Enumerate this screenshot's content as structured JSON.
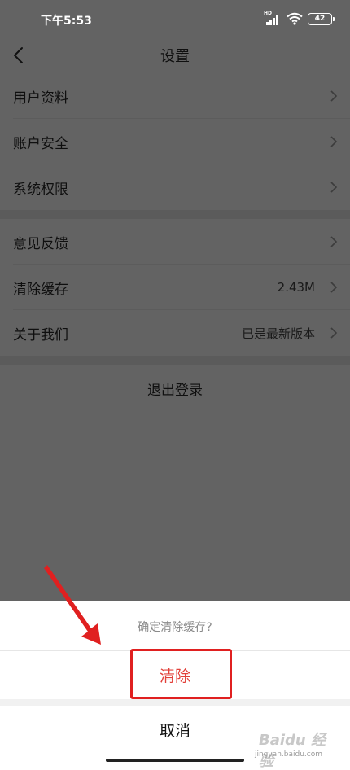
{
  "status_bar": {
    "time": "下午5:53",
    "signal_label": "HD",
    "battery_level": "42"
  },
  "nav": {
    "title": "设置"
  },
  "settings": {
    "group1": [
      {
        "label": "用户资料"
      },
      {
        "label": "账户安全"
      },
      {
        "label": "系统权限"
      }
    ],
    "group2": [
      {
        "label": "意见反馈",
        "value": ""
      },
      {
        "label": "清除缓存",
        "value": "2.43M"
      },
      {
        "label": "关于我们",
        "value": "已是最新版本"
      }
    ],
    "logout_label": "退出登录"
  },
  "sheet": {
    "title": "确定清除缓存?",
    "confirm_label": "清除",
    "cancel_label": "取消"
  },
  "watermark": {
    "logo": "Baidu 经验",
    "url": "jingyan.baidu.com"
  },
  "colors": {
    "dim_background": "#636363",
    "destructive": "#e2413a",
    "annotation": "#e02020"
  },
  "icons": [
    "back-arrow-icon",
    "chevron-right-icon",
    "signal-icon",
    "wifi-icon",
    "battery-icon"
  ]
}
